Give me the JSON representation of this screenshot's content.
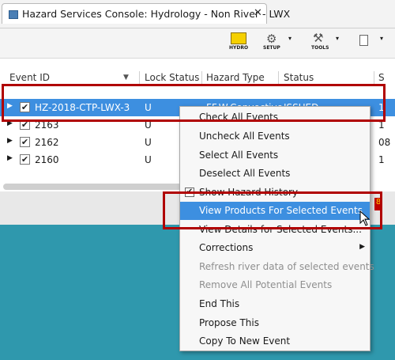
{
  "window": {
    "tab_title": "Hazard Services Console: Hydrology - Non River - LWX",
    "close_glyph": "✕"
  },
  "toolbar": {
    "hydro_label": "HYDRO",
    "setup_label": "SETUP",
    "tools_label": "TOOLS",
    "dropdown_glyph": "▾"
  },
  "table": {
    "columns": [
      "Event ID",
      "Lock Status",
      "Hazard Type",
      "Status",
      "S"
    ],
    "rows": [
      {
        "event_id": "HZ-2018-CTP-LWX-3",
        "lock": "U",
        "hazard_type": "FF.W.Convective",
        "status": "ISSUED",
        "s": "1",
        "checked": true,
        "selected": true
      },
      {
        "event_id": "2163",
        "lock": "U",
        "hazard_type": "",
        "status": "",
        "s": "1",
        "checked": true,
        "selected": false
      },
      {
        "event_id": "2162",
        "lock": "U",
        "hazard_type": "",
        "status": "",
        "s": "08",
        "checked": true,
        "selected": false
      },
      {
        "event_id": "2160",
        "lock": "U",
        "hazard_type": "",
        "status": "",
        "s": "1",
        "checked": true,
        "selected": false
      }
    ]
  },
  "context_menu": {
    "items": [
      {
        "label": "Check All Events",
        "enabled": true
      },
      {
        "label": "Uncheck All Events",
        "enabled": true
      },
      {
        "label": "Select All Events",
        "enabled": true
      },
      {
        "label": "Deselect All Events",
        "enabled": true
      },
      {
        "label": "Show Hazard History",
        "enabled": true,
        "checkbox": true
      },
      {
        "label": "View Products For Selected Events",
        "enabled": true,
        "highlighted": true
      },
      {
        "label": "View Details for Selected Events...",
        "enabled": true
      },
      {
        "label": "Corrections",
        "enabled": true,
        "submenu": true
      },
      {
        "label": "Refresh river data of selected events",
        "enabled": false
      },
      {
        "label": "Remove All Potential Events",
        "enabled": false
      },
      {
        "label": "End This",
        "enabled": true
      },
      {
        "label": "Propose This",
        "enabled": true
      },
      {
        "label": "Copy To New Event",
        "enabled": true
      }
    ]
  },
  "badge_text": "8",
  "colors": {
    "selection": "#3d8fe0",
    "annotation": "#b00000",
    "map_water": "#2f98ad"
  }
}
